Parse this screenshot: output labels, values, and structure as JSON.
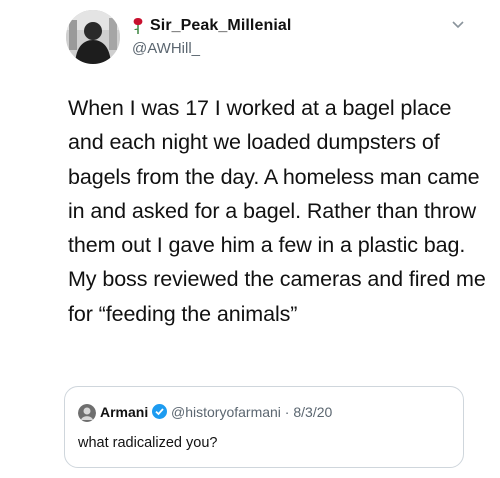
{
  "tweet": {
    "author": {
      "display_name": "Sir_Peak_Millenial",
      "handle": "@AWHill_",
      "avatar_icon": "profile-photo",
      "name_emoji_icon": "rose-icon"
    },
    "menu_icon": "chevron-down-icon",
    "text": "When I was 17 I worked at a bagel place and each night we loaded dumpsters of bagels from the day. A homeless man came in and asked for a bagel. Rather than throw them out I gave him a few in a plastic bag. My boss reviewed the cameras and fired me for “feeding the animals”"
  },
  "quoted_tweet": {
    "display_name": "Armani",
    "verified_icon": "verified-badge-icon",
    "handle_date": "@historyofarmani · 8/3/20",
    "text": "what radicalized you?"
  },
  "colors": {
    "text": "#111111",
    "secondary": "#5b6670",
    "verified": "#1d9bf0",
    "border": "#cfd6dc"
  }
}
